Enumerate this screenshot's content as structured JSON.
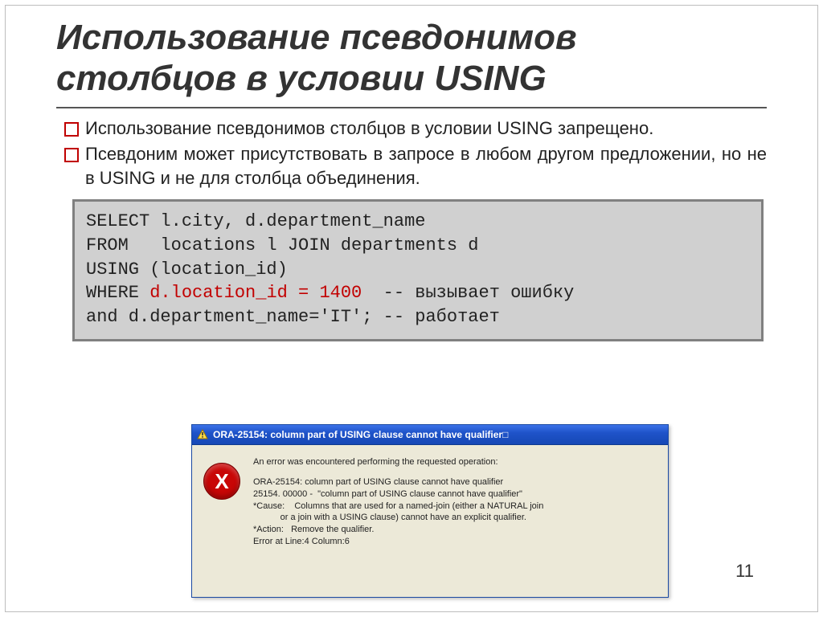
{
  "title_line1": "Использование псевдонимов",
  "title_line2": "столбцов в условии USING",
  "bullets": [
    "Использование псевдонимов столбцов в условии USING запрещено.",
    "Псевдоним может присутствовать в запросе в любом другом предложении, но не в USING и не для столбца объединения."
  ],
  "code": {
    "l1": "SELECT l.city, d.department_name",
    "l2": "FROM   locations l JOIN departments d",
    "l3": "USING (location_id)",
    "l4a": "WHERE ",
    "l4b_red": "d.location_id = 1400",
    "l4c": "  -- вызывает ошибку",
    "l5": "and d.department_name='IT'; -- работает"
  },
  "error_window": {
    "title": "ORA-25154: column part of USING clause cannot have qualifier□",
    "icon_letter": "X",
    "intro": "An error was encountered performing the requested operation:",
    "body": [
      "ORA-25154: column part of USING clause cannot have qualifier",
      "25154. 00000 -  \"column part of USING clause cannot have qualifier\"",
      "*Cause:    Columns that are used for a named-join (either a NATURAL join",
      "           or a join with a USING clause) cannot have an explicit qualifier.",
      "*Action:   Remove the qualifier.",
      "Error at Line:4 Column:6"
    ]
  },
  "page_number": "11"
}
